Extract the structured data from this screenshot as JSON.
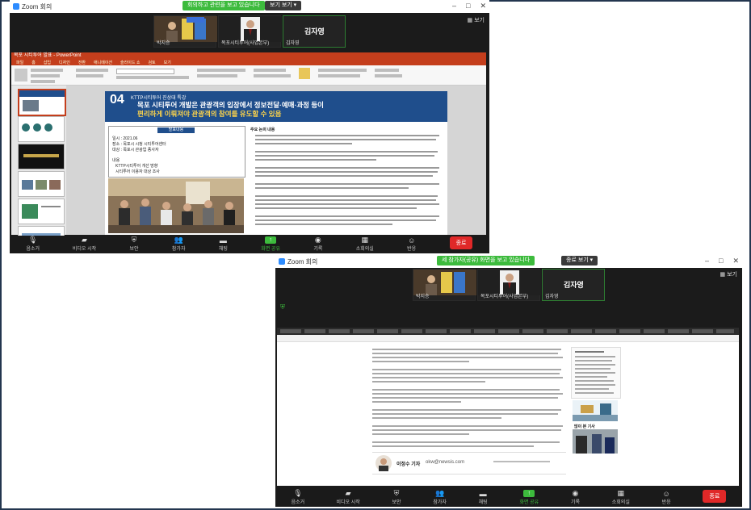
{
  "window1": {
    "title": "Zoom 회의",
    "banner": "회의하고 관련을 보고 있습니다",
    "view_button": "보기 보기 ▾",
    "gallery_label": "보기",
    "participants": [
      {
        "name": "박지승",
        "role": "photo"
      },
      {
        "name": "목포시티투어(사업본부)",
        "role": "photo"
      },
      {
        "name": "김자영",
        "role": "name-only"
      }
    ],
    "big_name": "김자영",
    "sub_name": "김자영",
    "ppt": {
      "titlebar": "목포 시티투어 발표 - PowerPoint",
      "tabs": [
        "파일",
        "홈",
        "삽입",
        "디자인",
        "전환",
        "애니메이션",
        "슬라이드 쇼",
        "검토",
        "보기"
      ],
      "slide_number": "04",
      "slide_tag": "KTTP시티투어 진상대 특강",
      "slide_title_1": "목포 시티투어 개발은 관광객의 입장에서 정보전달·예매·과정 등이",
      "slide_title_2": "편리하게 이뤄져야 관광객의 참여를 유도할 수 있음",
      "left_box_header": "발표내용",
      "left_items": [
        "일시 : 2021.06",
        "장소 : 목포시 시청 시티투어센터",
        "대상 : 목포시 관광업 종사자",
        "내용",
        "KTTP시티투어 개선 방향",
        "시티투어 이용자 대상 조사"
      ],
      "right_header": "주요 논의 내용"
    },
    "toolbar": [
      {
        "icon": "mic-icon",
        "label": "음소거"
      },
      {
        "icon": "video-off-icon",
        "label": "비디오 시작"
      },
      {
        "icon": "shield-icon",
        "label": "보안"
      },
      {
        "icon": "participants-icon",
        "label": "참가자",
        "count": "3"
      },
      {
        "icon": "chat-icon",
        "label": "채팅"
      },
      {
        "icon": "share-icon",
        "label": "화면 공유"
      },
      {
        "icon": "record-icon",
        "label": "기록"
      },
      {
        "icon": "rooms-icon",
        "label": "소회의실"
      },
      {
        "icon": "reactions-icon",
        "label": "반응"
      }
    ],
    "leave": "종료"
  },
  "window2": {
    "title": "Zoom 회의",
    "banner": "세 참가자(공유) 화면을 보고 있습니다",
    "view_button": "종료 보기 ▾",
    "gallery_label": "보기",
    "participants": [
      {
        "name": "박지승"
      },
      {
        "name": "목포시티투어(사업본부)"
      },
      {
        "name": "김자영"
      }
    ],
    "big_name": "김자영",
    "browser": {
      "reporter": "이정수 기자",
      "reporter_email": "okw@newsis.com",
      "side_title": "많이 본 기사"
    },
    "toolbar": [
      {
        "icon": "mic-icon",
        "label": "음소거"
      },
      {
        "icon": "video-off-icon",
        "label": "비디오 시작"
      },
      {
        "icon": "shield-icon",
        "label": "보안"
      },
      {
        "icon": "participants-icon",
        "label": "참가자",
        "count": "3"
      },
      {
        "icon": "chat-icon",
        "label": "채팅"
      },
      {
        "icon": "share-icon",
        "label": "화면 공유"
      },
      {
        "icon": "record-icon",
        "label": "기록"
      },
      {
        "icon": "rooms-icon",
        "label": "소회의실"
      },
      {
        "icon": "reactions-icon",
        "label": "반응"
      }
    ],
    "leave": "종료"
  }
}
